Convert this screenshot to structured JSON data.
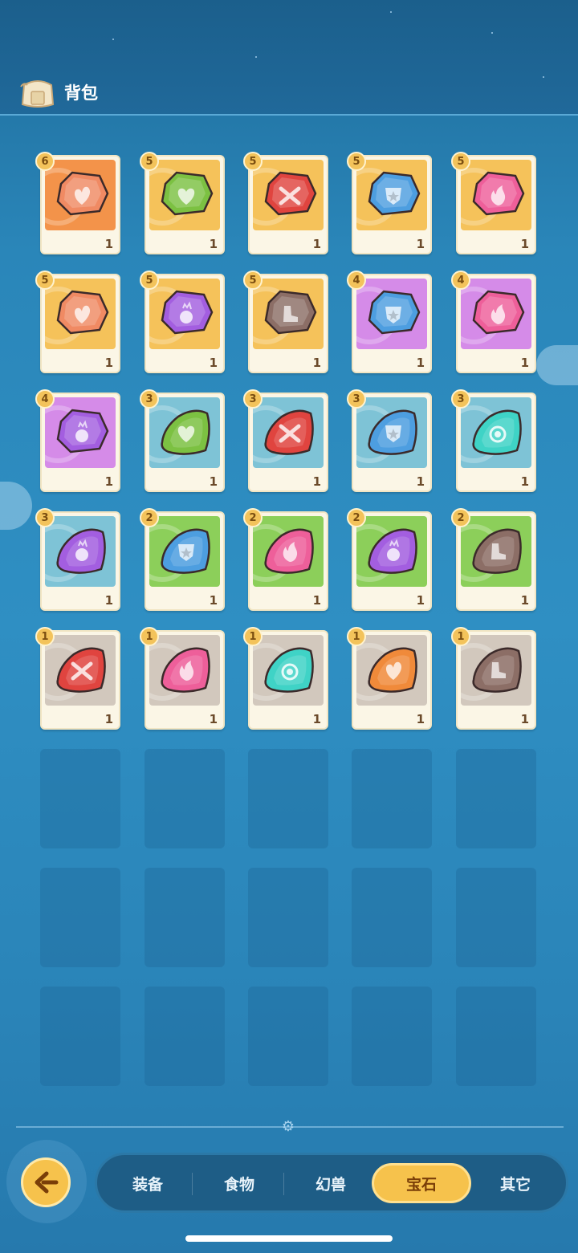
{
  "header": {
    "title": "背包",
    "icon": "backpack-icon"
  },
  "tabs": [
    {
      "label": "装备",
      "active": false
    },
    {
      "label": "食物",
      "active": false
    },
    {
      "label": "幻兽",
      "active": false
    },
    {
      "label": "宝石",
      "active": true
    },
    {
      "label": "其它",
      "active": false
    }
  ],
  "back_button": {
    "icon": "back-arrow-icon"
  },
  "gems": [
    {
      "level": "6",
      "qty": "1",
      "bg": "#f3934a",
      "color": "#f08a63",
      "shape": "square",
      "icon": "heart-flame-icon"
    },
    {
      "level": "5",
      "qty": "1",
      "bg": "#f5c25a",
      "color": "#7cc142",
      "shape": "square",
      "icon": "heart-icon"
    },
    {
      "level": "5",
      "qty": "1",
      "bg": "#f5c25a",
      "color": "#e0443f",
      "shape": "square",
      "icon": "swords-icon"
    },
    {
      "level": "5",
      "qty": "1",
      "bg": "#f5c25a",
      "color": "#4d9ee0",
      "shape": "square",
      "icon": "shield-star-icon"
    },
    {
      "level": "5",
      "qty": "1",
      "bg": "#f5c25a",
      "color": "#ee5f9a",
      "shape": "square",
      "icon": "fire-icon"
    },
    {
      "level": "5",
      "qty": "1",
      "bg": "#f5c25a",
      "color": "#f08a63",
      "shape": "square",
      "icon": "heart-flame-icon"
    },
    {
      "level": "5",
      "qty": "1",
      "bg": "#f5c25a",
      "color": "#a35ee0",
      "shape": "square",
      "icon": "orb-icon"
    },
    {
      "level": "5",
      "qty": "1",
      "bg": "#f5c25a",
      "color": "#8c6e66",
      "shape": "square",
      "icon": "boot-icon"
    },
    {
      "level": "4",
      "qty": "1",
      "bg": "#d58be8",
      "color": "#4d9ee0",
      "shape": "square",
      "icon": "shield-star-icon"
    },
    {
      "level": "4",
      "qty": "1",
      "bg": "#d58be8",
      "color": "#ee5f9a",
      "shape": "square",
      "icon": "fire-icon"
    },
    {
      "level": "4",
      "qty": "1",
      "bg": "#d58be8",
      "color": "#a35ee0",
      "shape": "square",
      "icon": "orb-icon"
    },
    {
      "level": "3",
      "qty": "1",
      "bg": "#7ec3d6",
      "color": "#7cc142",
      "shape": "tri",
      "icon": "heart-icon"
    },
    {
      "level": "3",
      "qty": "1",
      "bg": "#7ec3d6",
      "color": "#e0443f",
      "shape": "tri",
      "icon": "swords-icon"
    },
    {
      "level": "3",
      "qty": "1",
      "bg": "#7ec3d6",
      "color": "#4d9ee0",
      "shape": "tri",
      "icon": "shield-star-icon"
    },
    {
      "level": "3",
      "qty": "1",
      "bg": "#7ec3d6",
      "color": "#3fd3c6",
      "shape": "tri",
      "icon": "target-icon"
    },
    {
      "level": "3",
      "qty": "1",
      "bg": "#7ec3d6",
      "color": "#a35ee0",
      "shape": "tri",
      "icon": "orb-icon"
    },
    {
      "level": "2",
      "qty": "1",
      "bg": "#8ccf5a",
      "color": "#4d9ee0",
      "shape": "tri",
      "icon": "shield-star-icon"
    },
    {
      "level": "2",
      "qty": "1",
      "bg": "#8ccf5a",
      "color": "#ee5f9a",
      "shape": "tri",
      "icon": "fire-icon"
    },
    {
      "level": "2",
      "qty": "1",
      "bg": "#8ccf5a",
      "color": "#a35ee0",
      "shape": "tri",
      "icon": "orb-icon"
    },
    {
      "level": "2",
      "qty": "1",
      "bg": "#8ccf5a",
      "color": "#8c6e66",
      "shape": "tri",
      "icon": "boot-icon"
    },
    {
      "level": "1",
      "qty": "1",
      "bg": "#d2c8bd",
      "color": "#e0443f",
      "shape": "tri",
      "icon": "swords-icon"
    },
    {
      "level": "1",
      "qty": "1",
      "bg": "#d2c8bd",
      "color": "#ee5f9a",
      "shape": "tri",
      "icon": "fire-icon"
    },
    {
      "level": "1",
      "qty": "1",
      "bg": "#d2c8bd",
      "color": "#3fd3c6",
      "shape": "tri",
      "icon": "target-icon"
    },
    {
      "level": "1",
      "qty": "1",
      "bg": "#d2c8bd",
      "color": "#f08a3a",
      "shape": "tri",
      "icon": "heart-flame-icon"
    },
    {
      "level": "1",
      "qty": "1",
      "bg": "#d2c8bd",
      "color": "#8c6e66",
      "shape": "tri",
      "icon": "boot-icon"
    }
  ],
  "empty_slots": 15
}
